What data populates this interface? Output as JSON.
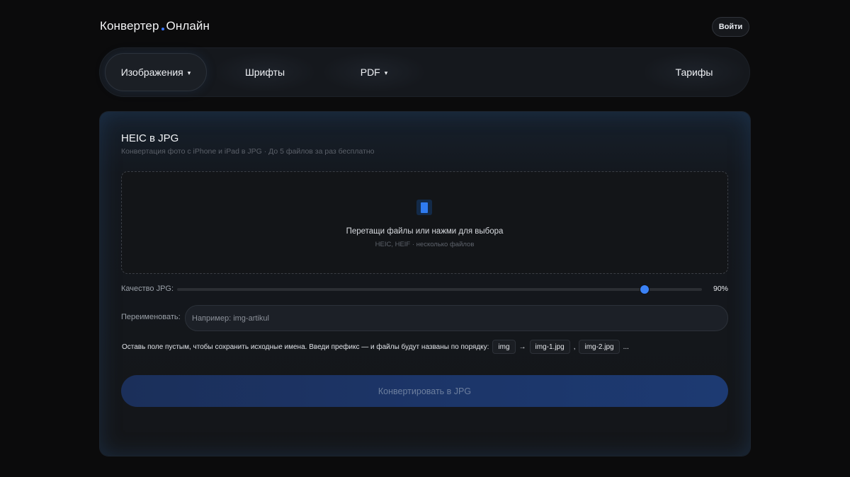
{
  "header": {
    "logo_part1": "Конвертер",
    "logo_part2": "Онлайн",
    "login_label": "Войти"
  },
  "nav": {
    "items": [
      {
        "label": "Изображения",
        "has_dropdown": true,
        "active": true
      },
      {
        "label": "Шрифты",
        "has_dropdown": false,
        "active": false
      },
      {
        "label": "PDF",
        "has_dropdown": true,
        "active": false
      },
      {
        "label": "Тарифы",
        "has_dropdown": false,
        "active": false
      }
    ],
    "caret": "▾"
  },
  "converter": {
    "title": "HEIC в JPG",
    "subtitle": "Конвертация фото с iPhone и iPad в JPG · До 5 файлов за раз бесплатно",
    "dropzone": {
      "icon": "file-icon",
      "text": "Перетащи файлы или нажми для выбора",
      "hint": "HEIC, HEIF · несколько файлов"
    },
    "quality": {
      "label": "Качество JPG:",
      "value": 90,
      "value_text": "90%"
    },
    "rename": {
      "label": "Переименовать:",
      "value": "",
      "placeholder": "Например: img-artikul"
    },
    "hint": {
      "text": "Оставь поле пустым, чтобы сохранить исходные имена. Введи префикс — и файлы будут названы по порядку:",
      "example_prefix": "img",
      "arrow": "→",
      "example_1": "img-1.jpg",
      "comma": ",",
      "example_2": "img-2.jpg",
      "ellipsis": "..."
    },
    "convert_label": "Конвертировать в JPG"
  },
  "colors": {
    "accent": "#3b82f6",
    "background": "#0b0b0c",
    "button": "#1c3568"
  }
}
